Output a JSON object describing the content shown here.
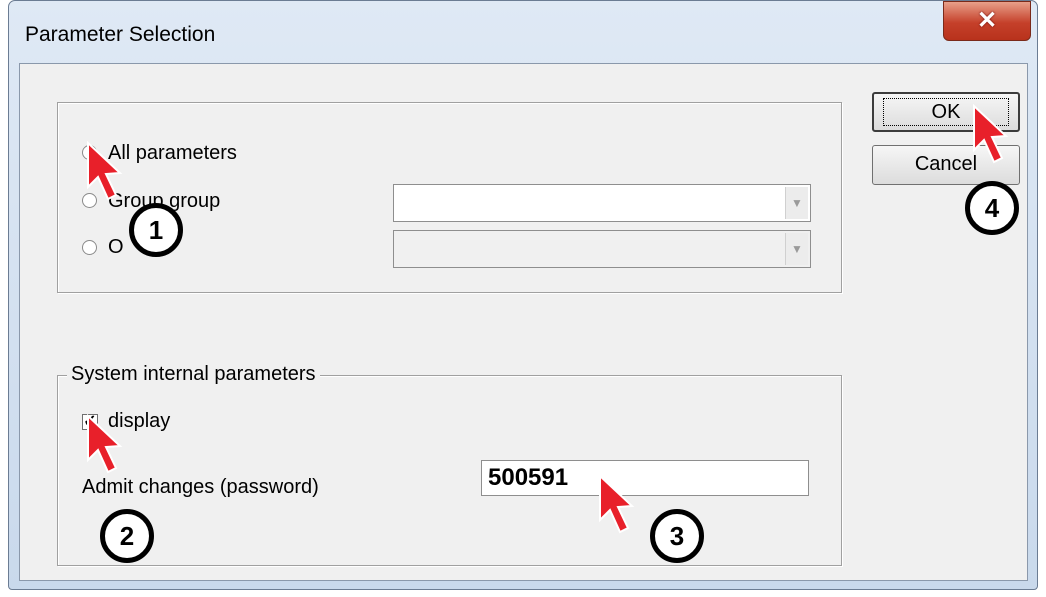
{
  "window": {
    "title": "Parameter Selection",
    "close_glyph": "✕"
  },
  "options": {
    "all_parameters": "All parameters",
    "group_label": "Group group",
    "other_label": "O"
  },
  "system": {
    "legend": "System internal parameters",
    "display_label": "display",
    "display_checked": true,
    "admit_label": "Admit changes (password)",
    "password_value": "500591"
  },
  "buttons": {
    "ok": "OK",
    "cancel": "Cancel"
  },
  "annotations": [
    "1",
    "2",
    "3",
    "4"
  ],
  "colors": {
    "cursor_red": "#e8202a",
    "title_bar": "#dfe9f5",
    "close_red": "#c5402a"
  }
}
